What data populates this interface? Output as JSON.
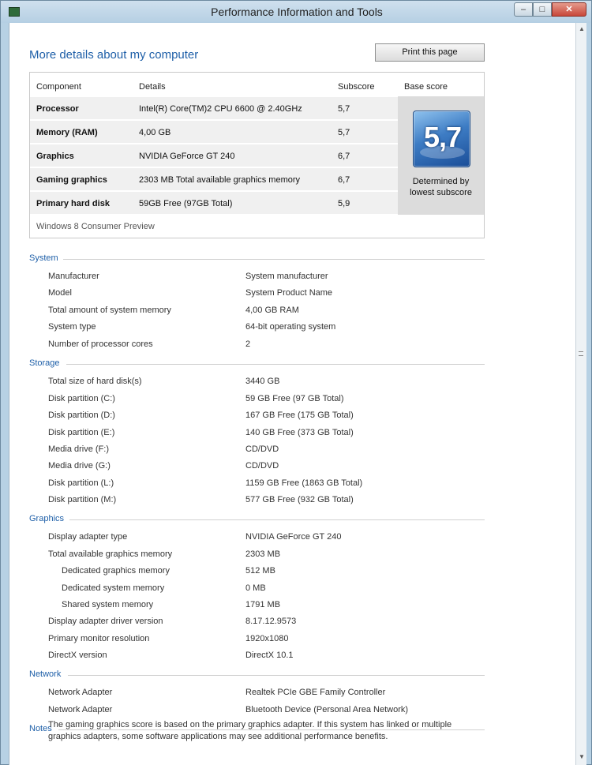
{
  "window": {
    "title": "Performance Information and Tools",
    "min_glyph": "–",
    "max_glyph": "□",
    "close_glyph": "✕"
  },
  "page": {
    "heading": "More details about my computer",
    "print_button": "Print this page"
  },
  "score_table": {
    "headers": [
      "Component",
      "Details",
      "Subscore",
      "Base score"
    ],
    "rows": [
      {
        "component": "Processor",
        "details": "Intel(R) Core(TM)2 CPU 6600 @ 2.40GHz",
        "subscore": "5,7"
      },
      {
        "component": "Memory (RAM)",
        "details": "4,00 GB",
        "subscore": "5,7"
      },
      {
        "component": "Graphics",
        "details": "NVIDIA GeForce GT 240",
        "subscore": "6,7"
      },
      {
        "component": "Gaming graphics",
        "details": "2303 MB Total available graphics memory",
        "subscore": "6,7"
      },
      {
        "component": "Primary hard disk",
        "details": "59GB Free (97GB Total)",
        "subscore": "5,9"
      }
    ],
    "base_score": "5,7",
    "base_caption_line1": "Determined by",
    "base_caption_line2": "lowest subscore",
    "os_name": "Windows 8 Consumer Preview"
  },
  "system": {
    "title": "System",
    "rows": [
      {
        "label": "Manufacturer",
        "value": "System manufacturer"
      },
      {
        "label": "Model",
        "value": "System Product Name"
      },
      {
        "label": "Total amount of system memory",
        "value": "4,00 GB RAM"
      },
      {
        "label": "System type",
        "value": "64-bit operating system"
      },
      {
        "label": "Number of processor cores",
        "value": "2"
      }
    ]
  },
  "storage": {
    "title": "Storage",
    "rows": [
      {
        "label": "Total size of hard disk(s)",
        "value": "3440 GB"
      },
      {
        "label": "Disk partition (C:)",
        "value": "59 GB Free (97 GB Total)"
      },
      {
        "label": "Disk partition (D:)",
        "value": "167 GB Free (175 GB Total)"
      },
      {
        "label": "Disk partition (E:)",
        "value": "140 GB Free (373 GB Total)"
      },
      {
        "label": "Media drive (F:)",
        "value": "CD/DVD"
      },
      {
        "label": "Media drive (G:)",
        "value": "CD/DVD"
      },
      {
        "label": "Disk partition (L:)",
        "value": "1159 GB Free (1863 GB Total)"
      },
      {
        "label": "Disk partition (M:)",
        "value": "577 GB Free (932 GB Total)"
      }
    ]
  },
  "graphics": {
    "title": "Graphics",
    "rows": [
      {
        "label": "Display adapter type",
        "value": "NVIDIA GeForce GT 240"
      },
      {
        "label": "Total available graphics memory",
        "value": "2303 MB"
      },
      {
        "label": "Dedicated graphics memory",
        "value": "512 MB"
      },
      {
        "label": "Dedicated system memory",
        "value": "0 MB"
      },
      {
        "label": "Shared system memory",
        "value": "1791 MB"
      },
      {
        "label": "Display adapter driver version",
        "value": "8.17.12.9573"
      },
      {
        "label": "Primary monitor resolution",
        "value": "1920x1080"
      },
      {
        "label": "DirectX version",
        "value": "DirectX 10.1"
      }
    ]
  },
  "network": {
    "title": "Network",
    "rows": [
      {
        "label": "Network Adapter",
        "value": "Realtek PCIe GBE Family Controller"
      },
      {
        "label": "Network Adapter",
        "value": "Bluetooth Device (Personal Area Network)"
      }
    ]
  },
  "notes": {
    "title": "Notes",
    "text": "The gaming graphics score is based on the primary graphics adapter. If this system has linked or multiple graphics adapters, some software applications may see additional performance benefits."
  }
}
